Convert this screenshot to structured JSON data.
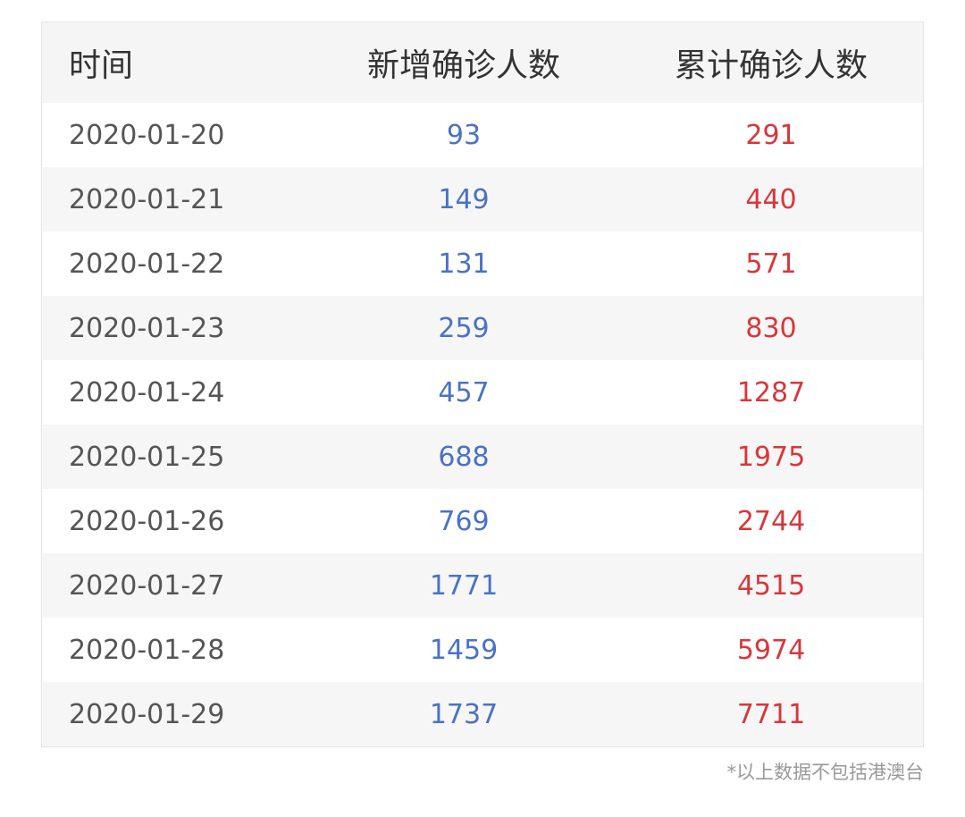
{
  "table": {
    "headers": {
      "time": "时间",
      "new_confirmed": "新增确诊人数",
      "total_confirmed": "累计确诊人数"
    },
    "rows": [
      {
        "date": "2020-01-20",
        "new": "93",
        "total": "291"
      },
      {
        "date": "2020-01-21",
        "new": "149",
        "total": "440"
      },
      {
        "date": "2020-01-22",
        "new": "131",
        "total": "571"
      },
      {
        "date": "2020-01-23",
        "new": "259",
        "total": "830"
      },
      {
        "date": "2020-01-24",
        "new": "457",
        "total": "1287"
      },
      {
        "date": "2020-01-25",
        "new": "688",
        "total": "1975"
      },
      {
        "date": "2020-01-26",
        "new": "769",
        "total": "2744"
      },
      {
        "date": "2020-01-27",
        "new": "1771",
        "total": "4515"
      },
      {
        "date": "2020-01-28",
        "new": "1459",
        "total": "5974"
      },
      {
        "date": "2020-01-29",
        "new": "1737",
        "total": "7711"
      }
    ]
  },
  "footnote": "*以上数据不包括港澳台",
  "colors": {
    "new_confirmed": "#4a72c4",
    "total_confirmed": "#d9363a",
    "date_text": "#555555",
    "header_bg": "#f5f5f5",
    "stripe_bg": "#f6f6f6"
  }
}
